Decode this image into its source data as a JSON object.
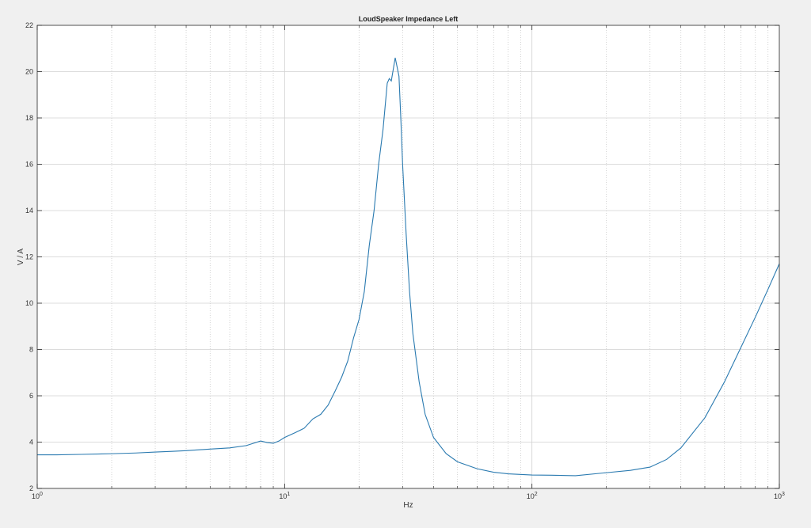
{
  "chart_data": {
    "type": "line",
    "title": "LoudSpeaker Impedance Left",
    "xlabel": "Hz",
    "ylabel": "V / A",
    "xscale": "log",
    "xlim": [
      1,
      1000
    ],
    "ylim": [
      2,
      22
    ],
    "grid": true,
    "x_ticks": [
      {
        "value": 1,
        "base": "10",
        "exp": "0"
      },
      {
        "value": 10,
        "base": "10",
        "exp": "1"
      },
      {
        "value": 100,
        "base": "10",
        "exp": "2"
      },
      {
        "value": 1000,
        "base": "10",
        "exp": "3"
      }
    ],
    "y_ticks": [
      2,
      4,
      6,
      8,
      10,
      12,
      14,
      16,
      18,
      20,
      22
    ],
    "y_tick_labels": [
      "2",
      "4",
      "6",
      "8",
      "10",
      "12",
      "14",
      "16",
      "18",
      "20",
      "22"
    ],
    "line_color": "#2a7ab0",
    "series": [
      {
        "x": [
          1,
          1.2,
          1.5,
          2,
          2.5,
          3,
          3.5,
          4,
          5,
          6,
          7,
          8,
          8.5,
          9,
          9.5,
          10,
          11,
          12,
          13,
          14,
          15,
          16,
          17,
          18,
          19,
          20,
          21,
          22,
          23,
          24,
          25,
          26,
          26.5,
          27,
          27.5,
          28,
          28.5,
          29,
          29.5,
          30,
          31,
          32,
          33,
          35,
          37,
          40,
          45,
          50,
          60,
          70,
          80,
          100,
          120,
          150,
          200,
          250,
          300,
          350,
          400,
          500,
          600,
          700,
          800,
          900,
          1000
        ],
        "y": [
          3.45,
          3.45,
          3.47,
          3.5,
          3.53,
          3.57,
          3.6,
          3.63,
          3.7,
          3.75,
          3.85,
          4.05,
          3.98,
          3.95,
          4.05,
          4.2,
          4.4,
          4.6,
          5.0,
          5.2,
          5.6,
          6.2,
          6.8,
          7.5,
          8.5,
          9.3,
          10.5,
          12.5,
          14.0,
          16.0,
          17.5,
          19.5,
          19.7,
          19.6,
          20.1,
          20.6,
          20.2,
          19.8,
          18.0,
          16.0,
          13.0,
          10.5,
          8.7,
          6.6,
          5.2,
          4.2,
          3.5,
          3.15,
          2.85,
          2.7,
          2.63,
          2.58,
          2.57,
          2.55,
          2.68,
          2.78,
          2.92,
          3.25,
          3.75,
          5.05,
          6.6,
          8.1,
          9.4,
          10.6,
          11.7
        ]
      }
    ]
  }
}
